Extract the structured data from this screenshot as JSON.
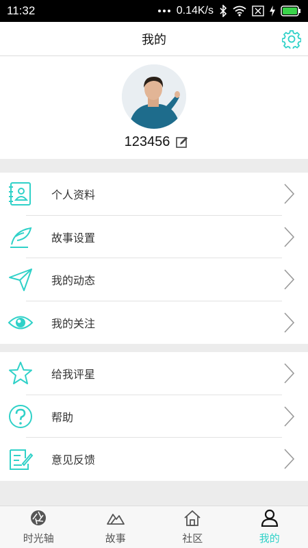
{
  "status_bar": {
    "time": "11:32",
    "network_speed": "0.14K/s"
  },
  "header": {
    "title": "我的"
  },
  "profile": {
    "username": "123456"
  },
  "menu_group1": [
    {
      "label": "个人资料",
      "icon": "contact-book-icon"
    },
    {
      "label": "故事设置",
      "icon": "feather-pen-icon"
    },
    {
      "label": "我的动态",
      "icon": "paper-plane-icon"
    },
    {
      "label": "我的关注",
      "icon": "eye-icon"
    }
  ],
  "menu_group2": [
    {
      "label": "给我评星",
      "icon": "star-icon"
    },
    {
      "label": "帮助",
      "icon": "question-icon"
    },
    {
      "label": "意见反馈",
      "icon": "feedback-note-icon"
    }
  ],
  "tabs": [
    {
      "label": "时光轴",
      "icon": "aperture-icon",
      "active": false
    },
    {
      "label": "故事",
      "icon": "mountain-icon",
      "active": false
    },
    {
      "label": "社区",
      "icon": "home-icon",
      "active": false
    },
    {
      "label": "我的",
      "icon": "person-icon",
      "active": true
    }
  ],
  "colors": {
    "accent": "#2fd1c8",
    "text": "#333333",
    "background": "#ececec"
  }
}
